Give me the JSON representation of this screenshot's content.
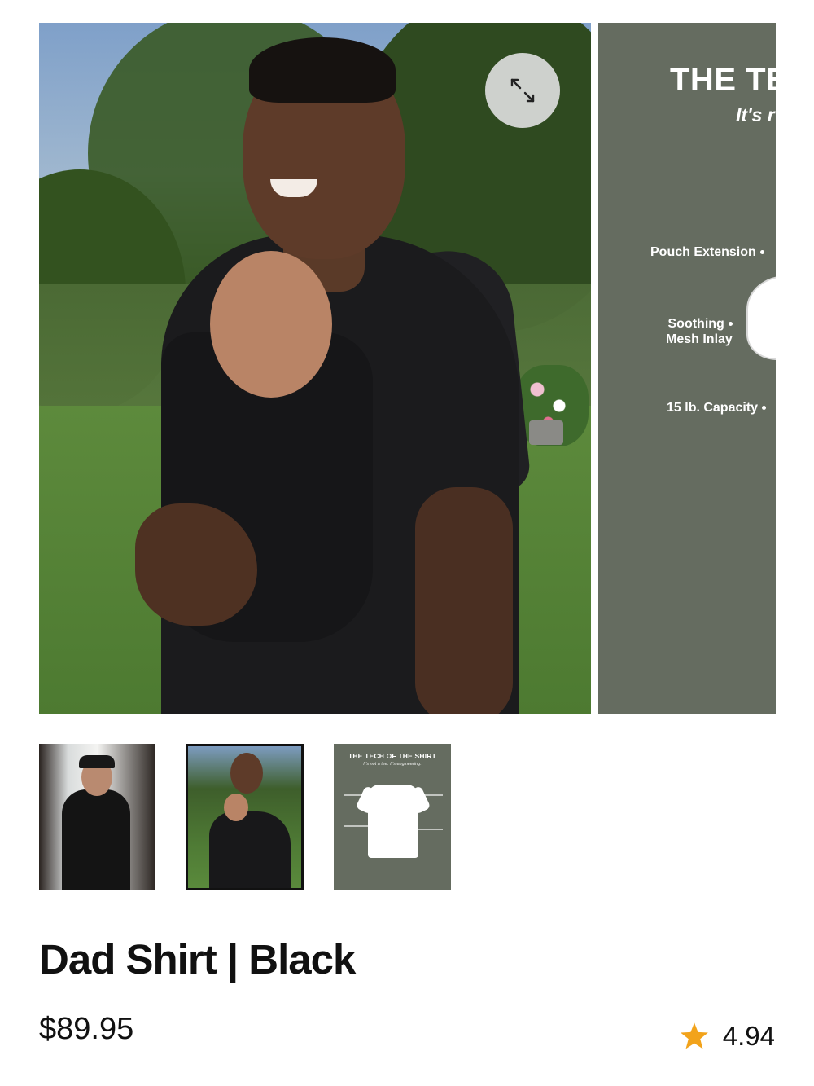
{
  "gallery": {
    "expand_icon": "expand-arrows-icon",
    "tech_slide": {
      "title": "THE TE",
      "subtitle": "It's r",
      "labels": [
        "Pouch Extension",
        "Soothing",
        "Mesh Inlay",
        "15 lb. Capacity"
      ]
    }
  },
  "thumbnails": {
    "tech_thumb": {
      "title": "THE TECH OF THE SHIRT",
      "subtitle": "It's not a tee. It's engineering."
    },
    "selected_index": 1
  },
  "product": {
    "title": "Dad Shirt | Black",
    "price": "$89.95",
    "rating": "4.94",
    "rating_icon": "star-icon",
    "star_color": "#f2a31b"
  }
}
